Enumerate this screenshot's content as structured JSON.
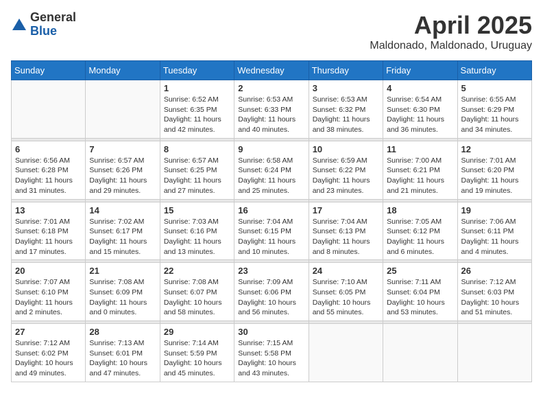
{
  "logo": {
    "general": "General",
    "blue": "Blue"
  },
  "header": {
    "month": "April 2025",
    "location": "Maldonado, Maldonado, Uruguay"
  },
  "weekdays": [
    "Sunday",
    "Monday",
    "Tuesday",
    "Wednesday",
    "Thursday",
    "Friday",
    "Saturday"
  ],
  "weeks": [
    [
      {
        "day": "",
        "detail": ""
      },
      {
        "day": "",
        "detail": ""
      },
      {
        "day": "1",
        "detail": "Sunrise: 6:52 AM\nSunset: 6:35 PM\nDaylight: 11 hours and 42 minutes."
      },
      {
        "day": "2",
        "detail": "Sunrise: 6:53 AM\nSunset: 6:33 PM\nDaylight: 11 hours and 40 minutes."
      },
      {
        "day": "3",
        "detail": "Sunrise: 6:53 AM\nSunset: 6:32 PM\nDaylight: 11 hours and 38 minutes."
      },
      {
        "day": "4",
        "detail": "Sunrise: 6:54 AM\nSunset: 6:30 PM\nDaylight: 11 hours and 36 minutes."
      },
      {
        "day": "5",
        "detail": "Sunrise: 6:55 AM\nSunset: 6:29 PM\nDaylight: 11 hours and 34 minutes."
      }
    ],
    [
      {
        "day": "6",
        "detail": "Sunrise: 6:56 AM\nSunset: 6:28 PM\nDaylight: 11 hours and 31 minutes."
      },
      {
        "day": "7",
        "detail": "Sunrise: 6:57 AM\nSunset: 6:26 PM\nDaylight: 11 hours and 29 minutes."
      },
      {
        "day": "8",
        "detail": "Sunrise: 6:57 AM\nSunset: 6:25 PM\nDaylight: 11 hours and 27 minutes."
      },
      {
        "day": "9",
        "detail": "Sunrise: 6:58 AM\nSunset: 6:24 PM\nDaylight: 11 hours and 25 minutes."
      },
      {
        "day": "10",
        "detail": "Sunrise: 6:59 AM\nSunset: 6:22 PM\nDaylight: 11 hours and 23 minutes."
      },
      {
        "day": "11",
        "detail": "Sunrise: 7:00 AM\nSunset: 6:21 PM\nDaylight: 11 hours and 21 minutes."
      },
      {
        "day": "12",
        "detail": "Sunrise: 7:01 AM\nSunset: 6:20 PM\nDaylight: 11 hours and 19 minutes."
      }
    ],
    [
      {
        "day": "13",
        "detail": "Sunrise: 7:01 AM\nSunset: 6:18 PM\nDaylight: 11 hours and 17 minutes."
      },
      {
        "day": "14",
        "detail": "Sunrise: 7:02 AM\nSunset: 6:17 PM\nDaylight: 11 hours and 15 minutes."
      },
      {
        "day": "15",
        "detail": "Sunrise: 7:03 AM\nSunset: 6:16 PM\nDaylight: 11 hours and 13 minutes."
      },
      {
        "day": "16",
        "detail": "Sunrise: 7:04 AM\nSunset: 6:15 PM\nDaylight: 11 hours and 10 minutes."
      },
      {
        "day": "17",
        "detail": "Sunrise: 7:04 AM\nSunset: 6:13 PM\nDaylight: 11 hours and 8 minutes."
      },
      {
        "day": "18",
        "detail": "Sunrise: 7:05 AM\nSunset: 6:12 PM\nDaylight: 11 hours and 6 minutes."
      },
      {
        "day": "19",
        "detail": "Sunrise: 7:06 AM\nSunset: 6:11 PM\nDaylight: 11 hours and 4 minutes."
      }
    ],
    [
      {
        "day": "20",
        "detail": "Sunrise: 7:07 AM\nSunset: 6:10 PM\nDaylight: 11 hours and 2 minutes."
      },
      {
        "day": "21",
        "detail": "Sunrise: 7:08 AM\nSunset: 6:09 PM\nDaylight: 11 hours and 0 minutes."
      },
      {
        "day": "22",
        "detail": "Sunrise: 7:08 AM\nSunset: 6:07 PM\nDaylight: 10 hours and 58 minutes."
      },
      {
        "day": "23",
        "detail": "Sunrise: 7:09 AM\nSunset: 6:06 PM\nDaylight: 10 hours and 56 minutes."
      },
      {
        "day": "24",
        "detail": "Sunrise: 7:10 AM\nSunset: 6:05 PM\nDaylight: 10 hours and 55 minutes."
      },
      {
        "day": "25",
        "detail": "Sunrise: 7:11 AM\nSunset: 6:04 PM\nDaylight: 10 hours and 53 minutes."
      },
      {
        "day": "26",
        "detail": "Sunrise: 7:12 AM\nSunset: 6:03 PM\nDaylight: 10 hours and 51 minutes."
      }
    ],
    [
      {
        "day": "27",
        "detail": "Sunrise: 7:12 AM\nSunset: 6:02 PM\nDaylight: 10 hours and 49 minutes."
      },
      {
        "day": "28",
        "detail": "Sunrise: 7:13 AM\nSunset: 6:01 PM\nDaylight: 10 hours and 47 minutes."
      },
      {
        "day": "29",
        "detail": "Sunrise: 7:14 AM\nSunset: 5:59 PM\nDaylight: 10 hours and 45 minutes."
      },
      {
        "day": "30",
        "detail": "Sunrise: 7:15 AM\nSunset: 5:58 PM\nDaylight: 10 hours and 43 minutes."
      },
      {
        "day": "",
        "detail": ""
      },
      {
        "day": "",
        "detail": ""
      },
      {
        "day": "",
        "detail": ""
      }
    ]
  ]
}
